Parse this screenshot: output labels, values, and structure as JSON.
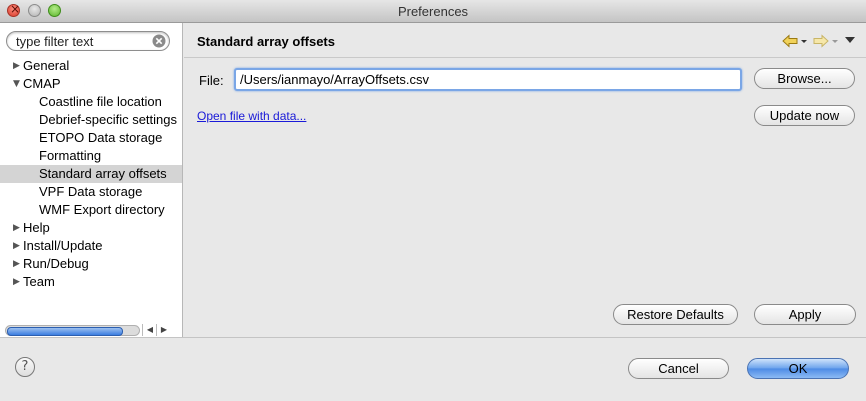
{
  "window": {
    "title": "Preferences"
  },
  "filter": {
    "placeholder": "type filter text"
  },
  "tree": [
    {
      "label": "General",
      "level": 0,
      "expandable": true,
      "expanded": false,
      "selected": false
    },
    {
      "label": "CMAP",
      "level": 0,
      "expandable": true,
      "expanded": true,
      "selected": false
    },
    {
      "label": "Coastline file location",
      "level": 1,
      "expandable": false,
      "selected": false
    },
    {
      "label": "Debrief-specific settings",
      "level": 1,
      "expandable": false,
      "selected": false
    },
    {
      "label": "ETOPO Data storage",
      "level": 1,
      "expandable": false,
      "selected": false
    },
    {
      "label": "Formatting",
      "level": 1,
      "expandable": false,
      "selected": false
    },
    {
      "label": "Standard array offsets",
      "level": 1,
      "expandable": false,
      "selected": true
    },
    {
      "label": "VPF Data storage",
      "level": 1,
      "expandable": false,
      "selected": false
    },
    {
      "label": "WMF Export directory",
      "level": 1,
      "expandable": false,
      "selected": false
    },
    {
      "label": "Help",
      "level": 0,
      "expandable": true,
      "expanded": false,
      "selected": false
    },
    {
      "label": "Install/Update",
      "level": 0,
      "expandable": true,
      "expanded": false,
      "selected": false
    },
    {
      "label": "Run/Debug",
      "level": 0,
      "expandable": true,
      "expanded": false,
      "selected": false
    },
    {
      "label": "Team",
      "level": 0,
      "expandable": true,
      "expanded": false,
      "selected": false
    }
  ],
  "page": {
    "title": "Standard array offsets",
    "file_label": "File:",
    "file_value": "/Users/ianmayo/ArrayOffsets.csv",
    "browse_label": "Browse...",
    "update_label": "Update now",
    "open_link": "Open file with data...",
    "restore_label": "Restore Defaults",
    "apply_label": "Apply"
  },
  "dialog": {
    "help_glyph": "?",
    "cancel_label": "Cancel",
    "ok_label": "OK"
  },
  "icons": {
    "back": "back-arrow-icon",
    "forward": "forward-arrow-icon",
    "menu": "view-menu-icon",
    "clear": "clear-filter-icon"
  },
  "colors": {
    "accent": "#4d8be5",
    "link": "#1a1ad8",
    "selection": "#d4d4d4"
  }
}
